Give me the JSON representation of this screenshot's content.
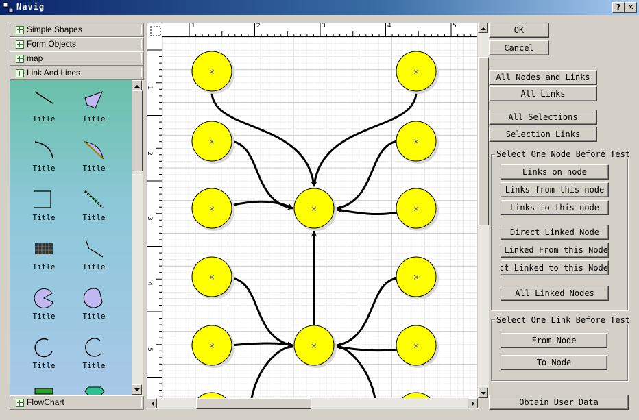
{
  "window": {
    "title": "Navig",
    "help_label": "?",
    "close_label": "✕"
  },
  "palette": {
    "categories_top": [
      {
        "label": "Simple Shapes"
      },
      {
        "label": "Form Objects"
      },
      {
        "label": "map"
      },
      {
        "label": "Link And Lines"
      }
    ],
    "category_bottom": {
      "label": "FlowChart"
    },
    "items": [
      {
        "label": "Title",
        "icon": "line-icon"
      },
      {
        "label": "Title",
        "icon": "polygon-icon"
      },
      {
        "label": "Title",
        "icon": "arc-icon"
      },
      {
        "label": "Title",
        "icon": "pie-icon"
      },
      {
        "label": "Title",
        "icon": "bracket-icon"
      },
      {
        "label": "Title",
        "icon": "dimension-icon"
      },
      {
        "label": "Title",
        "icon": "grid-icon"
      },
      {
        "label": "Title",
        "icon": "polyline-icon"
      },
      {
        "label": "Title",
        "icon": "pacman-icon"
      },
      {
        "label": "Title",
        "icon": "chord-icon"
      },
      {
        "label": "Title",
        "icon": "open-arc-icon"
      },
      {
        "label": "Title",
        "icon": "open-circle-icon"
      },
      {
        "label": "",
        "icon": "connector-icon"
      },
      {
        "label": "",
        "icon": "tag-icon"
      }
    ]
  },
  "ruler": {
    "top_numbers": [
      "1",
      "2",
      "3",
      "4",
      "5"
    ],
    "left_numbers": [
      "1",
      "2",
      "3",
      "4",
      "5"
    ]
  },
  "buttons": {
    "ok": "OK",
    "cancel": "Cancel",
    "all_nodes_links": "All Nodes and Links",
    "all_links": "All Links",
    "all_selections": "All Selections",
    "selection_links": "Selection Links",
    "links_on_node": "Links on node",
    "links_from_node": "Links from this node",
    "links_to_node": "Links to this node",
    "direct_linked_node": "Direct Linked Node",
    "direct_linked_from": "Direct Linked From this Node",
    "direct_linked_to": "Direct Linked to this Node",
    "all_linked_nodes": "All Linked Nodes",
    "from_node": "From Node",
    "to_node": "To Node",
    "obtain_user_data": "Obtain User Data"
  },
  "groups": {
    "node_test": "Select One Node Before Test",
    "link_test": "Select One Link Before Test"
  },
  "colors": {
    "node_fill": "#ffff00",
    "node_marker": "#3a50c8",
    "title_bar": "#0a246a"
  }
}
